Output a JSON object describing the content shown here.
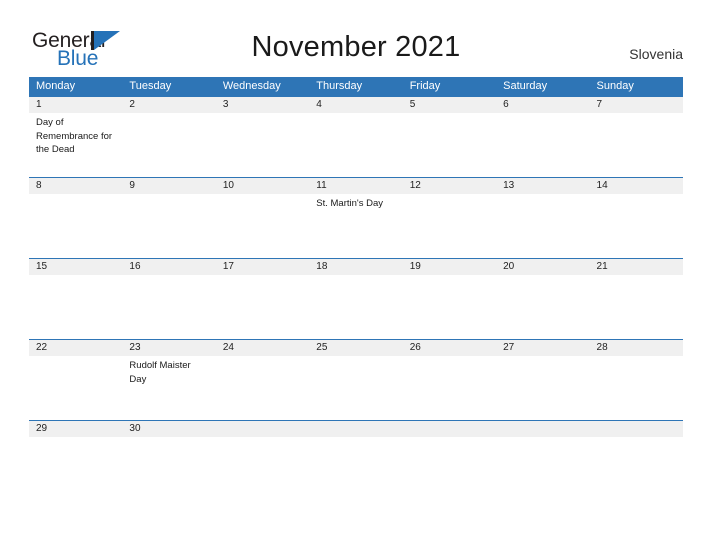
{
  "brand": {
    "line1": "General",
    "line2": "Blue",
    "triangle_color": "#2572b8",
    "text_color": "#231f20"
  },
  "header": {
    "title": "November 2021",
    "region": "Slovenia",
    "header_bg": "#2e75b6",
    "row_bg": "#f0f0f0"
  },
  "calendar": {
    "weekday_headers": [
      "Monday",
      "Tuesday",
      "Wednesday",
      "Thursday",
      "Friday",
      "Saturday",
      "Sunday"
    ],
    "weeks": [
      {
        "days": [
          {
            "num": "1",
            "event": "Day of Remembrance for the Dead"
          },
          {
            "num": "2",
            "event": ""
          },
          {
            "num": "3",
            "event": ""
          },
          {
            "num": "4",
            "event": ""
          },
          {
            "num": "5",
            "event": ""
          },
          {
            "num": "6",
            "event": ""
          },
          {
            "num": "7",
            "event": ""
          }
        ]
      },
      {
        "days": [
          {
            "num": "8",
            "event": ""
          },
          {
            "num": "9",
            "event": ""
          },
          {
            "num": "10",
            "event": ""
          },
          {
            "num": "11",
            "event": "St. Martin's Day"
          },
          {
            "num": "12",
            "event": ""
          },
          {
            "num": "13",
            "event": ""
          },
          {
            "num": "14",
            "event": ""
          }
        ]
      },
      {
        "days": [
          {
            "num": "15",
            "event": ""
          },
          {
            "num": "16",
            "event": ""
          },
          {
            "num": "17",
            "event": ""
          },
          {
            "num": "18",
            "event": ""
          },
          {
            "num": "19",
            "event": ""
          },
          {
            "num": "20",
            "event": ""
          },
          {
            "num": "21",
            "event": ""
          }
        ]
      },
      {
        "days": [
          {
            "num": "22",
            "event": ""
          },
          {
            "num": "23",
            "event": "Rudolf Maister Day"
          },
          {
            "num": "24",
            "event": ""
          },
          {
            "num": "25",
            "event": ""
          },
          {
            "num": "26",
            "event": ""
          },
          {
            "num": "27",
            "event": ""
          },
          {
            "num": "28",
            "event": ""
          }
        ]
      },
      {
        "days": [
          {
            "num": "29",
            "event": ""
          },
          {
            "num": "30",
            "event": ""
          },
          {
            "num": "",
            "event": ""
          },
          {
            "num": "",
            "event": ""
          },
          {
            "num": "",
            "event": ""
          },
          {
            "num": "",
            "event": ""
          },
          {
            "num": "",
            "event": ""
          }
        ]
      }
    ]
  }
}
